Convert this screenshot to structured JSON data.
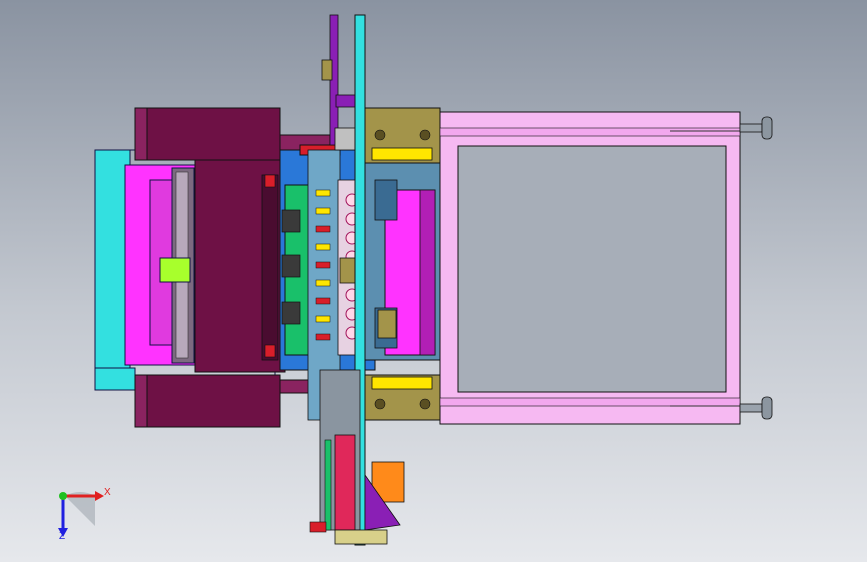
{
  "viewport": {
    "background_top": "#8a93a1",
    "background_bottom": "#e6e8ec"
  },
  "model": {
    "colors": {
      "maroon": "#6e1145",
      "maroon_light": "#8a2360",
      "magenta": "#ff33ff",
      "cyan": "#33e0e0",
      "pink": "#f6b9f2",
      "blue": "#2a78d8",
      "green": "#19c06a",
      "yellow": "#ffe600",
      "orange": "#ff8a1a",
      "olive": "#a3944a",
      "purple": "#8a1fb5",
      "red": "#d81e2a",
      "steel": "#5c8fb0",
      "lime": "#a8ff2c"
    }
  },
  "triad": {
    "x_label": "X",
    "z_label": "Z",
    "x_color": "#e02020",
    "y_color": "#20c020",
    "z_color": "#2020e0"
  }
}
